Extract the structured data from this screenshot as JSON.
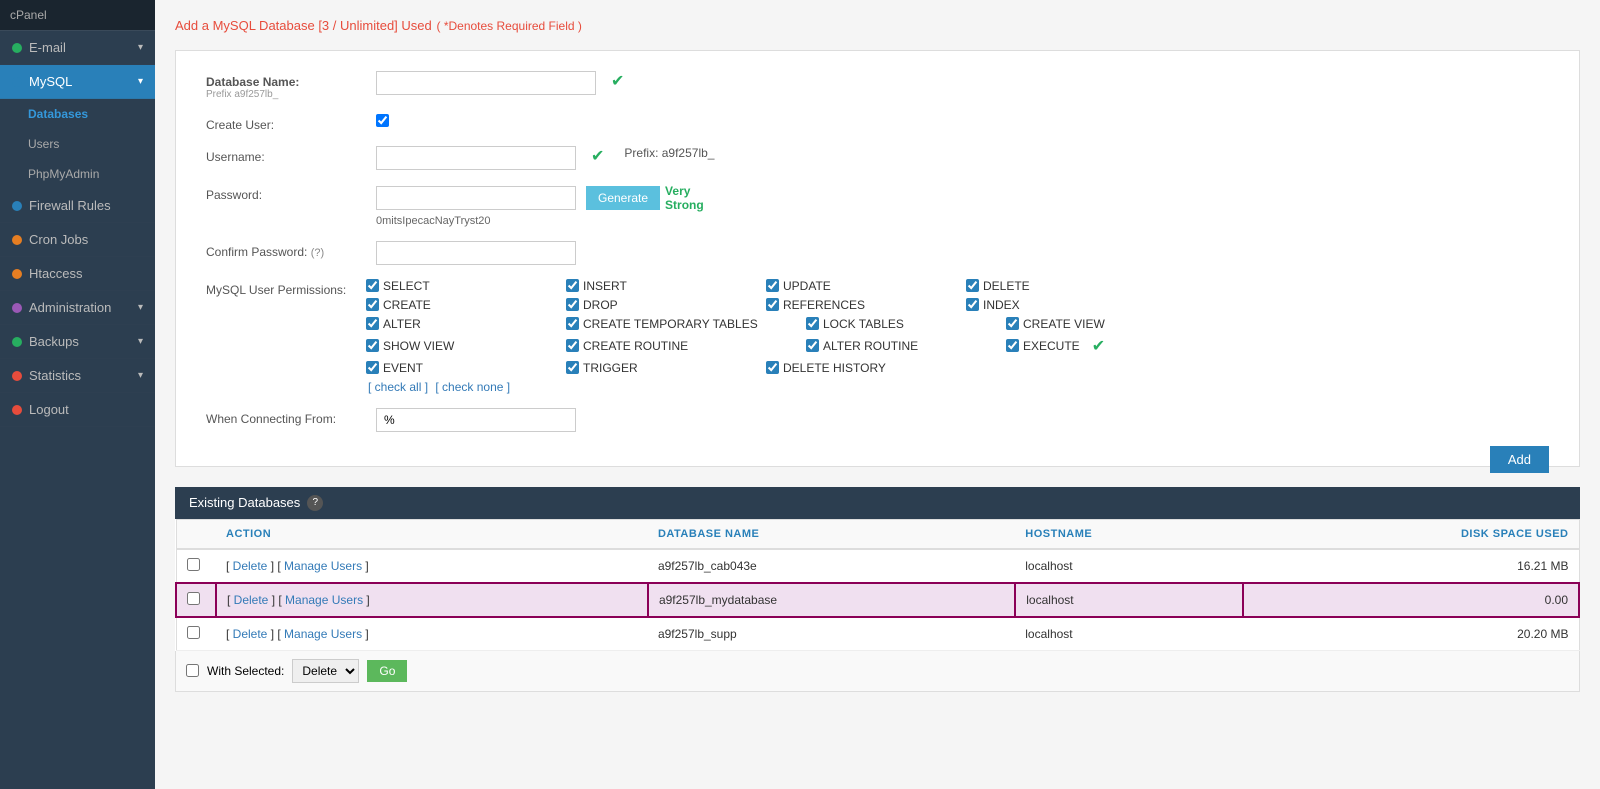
{
  "sidebar": {
    "header": "cPanel",
    "items": [
      {
        "id": "email",
        "label": "E-mail",
        "dot": "green",
        "hasArrow": true
      },
      {
        "id": "mysql",
        "label": "MySQL",
        "dot": "blue",
        "hasArrow": true,
        "active": true
      },
      {
        "id": "databases",
        "label": "Databases",
        "sub": true,
        "active": true
      },
      {
        "id": "users",
        "label": "Users",
        "sub": true
      },
      {
        "id": "phpmyadmin",
        "label": "PhpMyAdmin",
        "sub": true
      },
      {
        "id": "firewall",
        "label": "Firewall Rules",
        "dot": "blue",
        "hasArrow": false
      },
      {
        "id": "cron",
        "label": "Cron Jobs",
        "dot": "orange",
        "hasArrow": false
      },
      {
        "id": "htaccess",
        "label": "Htaccess",
        "dot": "orange",
        "hasArrow": false
      },
      {
        "id": "administration",
        "label": "Administration",
        "dot": "purple",
        "hasArrow": true
      },
      {
        "id": "backups",
        "label": "Backups",
        "dot": "green",
        "hasArrow": true
      },
      {
        "id": "statistics",
        "label": "Statistics",
        "dot": "red",
        "hasArrow": true
      },
      {
        "id": "logout",
        "label": "Logout",
        "dot": "red",
        "hasArrow": false
      }
    ]
  },
  "page": {
    "title": "Add a MySQL Database [3 / Unlimited] Used",
    "subtitle": "( *Denotes Required Field )",
    "form": {
      "db_name_label": "Database Name:",
      "db_name_prefix": "Prefix a9f257lb_",
      "create_user_label": "Create User:",
      "username_label": "Username:",
      "username_prefix": "Prefix: a9f257lb_",
      "password_label": "Password:",
      "password_hint": "0mitsIpecacNayTryst20",
      "strength_line1": "Very",
      "strength_line2": "Strong",
      "confirm_password_label": "Confirm Password:",
      "confirm_help": "(?)",
      "permissions_label": "MySQL User Permissions:",
      "permissions": [
        {
          "col": 0,
          "label": "SELECT",
          "checked": true
        },
        {
          "col": 1,
          "label": "INSERT",
          "checked": true
        },
        {
          "col": 2,
          "label": "UPDATE",
          "checked": true
        },
        {
          "col": 3,
          "label": "DELETE",
          "checked": true
        },
        {
          "col": 0,
          "label": "CREATE",
          "checked": true
        },
        {
          "col": 1,
          "label": "DROP",
          "checked": true
        },
        {
          "col": 2,
          "label": "REFERENCES",
          "checked": true
        },
        {
          "col": 3,
          "label": "INDEX",
          "checked": true
        },
        {
          "col": 0,
          "label": "ALTER",
          "checked": true
        },
        {
          "col": 1,
          "label": "CREATE TEMPORARY TABLES",
          "checked": true
        },
        {
          "col": 2,
          "label": "LOCK TABLES",
          "checked": true
        },
        {
          "col": 3,
          "label": "CREATE VIEW",
          "checked": true
        },
        {
          "col": 0,
          "label": "SHOW VIEW",
          "checked": true
        },
        {
          "col": 1,
          "label": "CREATE ROUTINE",
          "checked": true
        },
        {
          "col": 2,
          "label": "ALTER ROUTINE",
          "checked": true
        },
        {
          "col": 3,
          "label": "EXECUTE",
          "checked": true
        },
        {
          "col": 0,
          "label": "EVENT",
          "checked": true
        },
        {
          "col": 1,
          "label": "TRIGGER",
          "checked": true
        },
        {
          "col": 2,
          "label": "DELETE HISTORY",
          "checked": true
        }
      ],
      "check_all": "[ check all ]",
      "check_none": "[ check none ]",
      "connecting_from_label": "When Connecting From:",
      "connecting_from_value": "%",
      "add_btn": "Add"
    },
    "existing_section": {
      "title": "Existing Databases",
      "help": "?",
      "table": {
        "headers": [
          "ACTION",
          "DATABASE NAME",
          "HOSTNAME",
          "DISK SPACE USED"
        ],
        "rows": [
          {
            "action_delete": "Delete",
            "action_manage": "Manage Users",
            "name": "a9f257lb_cab043e",
            "hostname": "localhost",
            "disk": "16.21 MB",
            "highlighted": false
          },
          {
            "action_delete": "Delete",
            "action_manage": "Manage Users",
            "name": "a9f257lb_mydatabase",
            "hostname": "localhost",
            "disk": "0.00",
            "highlighted": true
          },
          {
            "action_delete": "Delete",
            "action_manage": "Manage Users",
            "name": "a9f257lb_supp",
            "hostname": "localhost",
            "disk": "20.20 MB",
            "highlighted": false
          }
        ],
        "with_selected": "With Selected:",
        "delete_option": "Delete",
        "go_btn": "Go"
      }
    }
  }
}
